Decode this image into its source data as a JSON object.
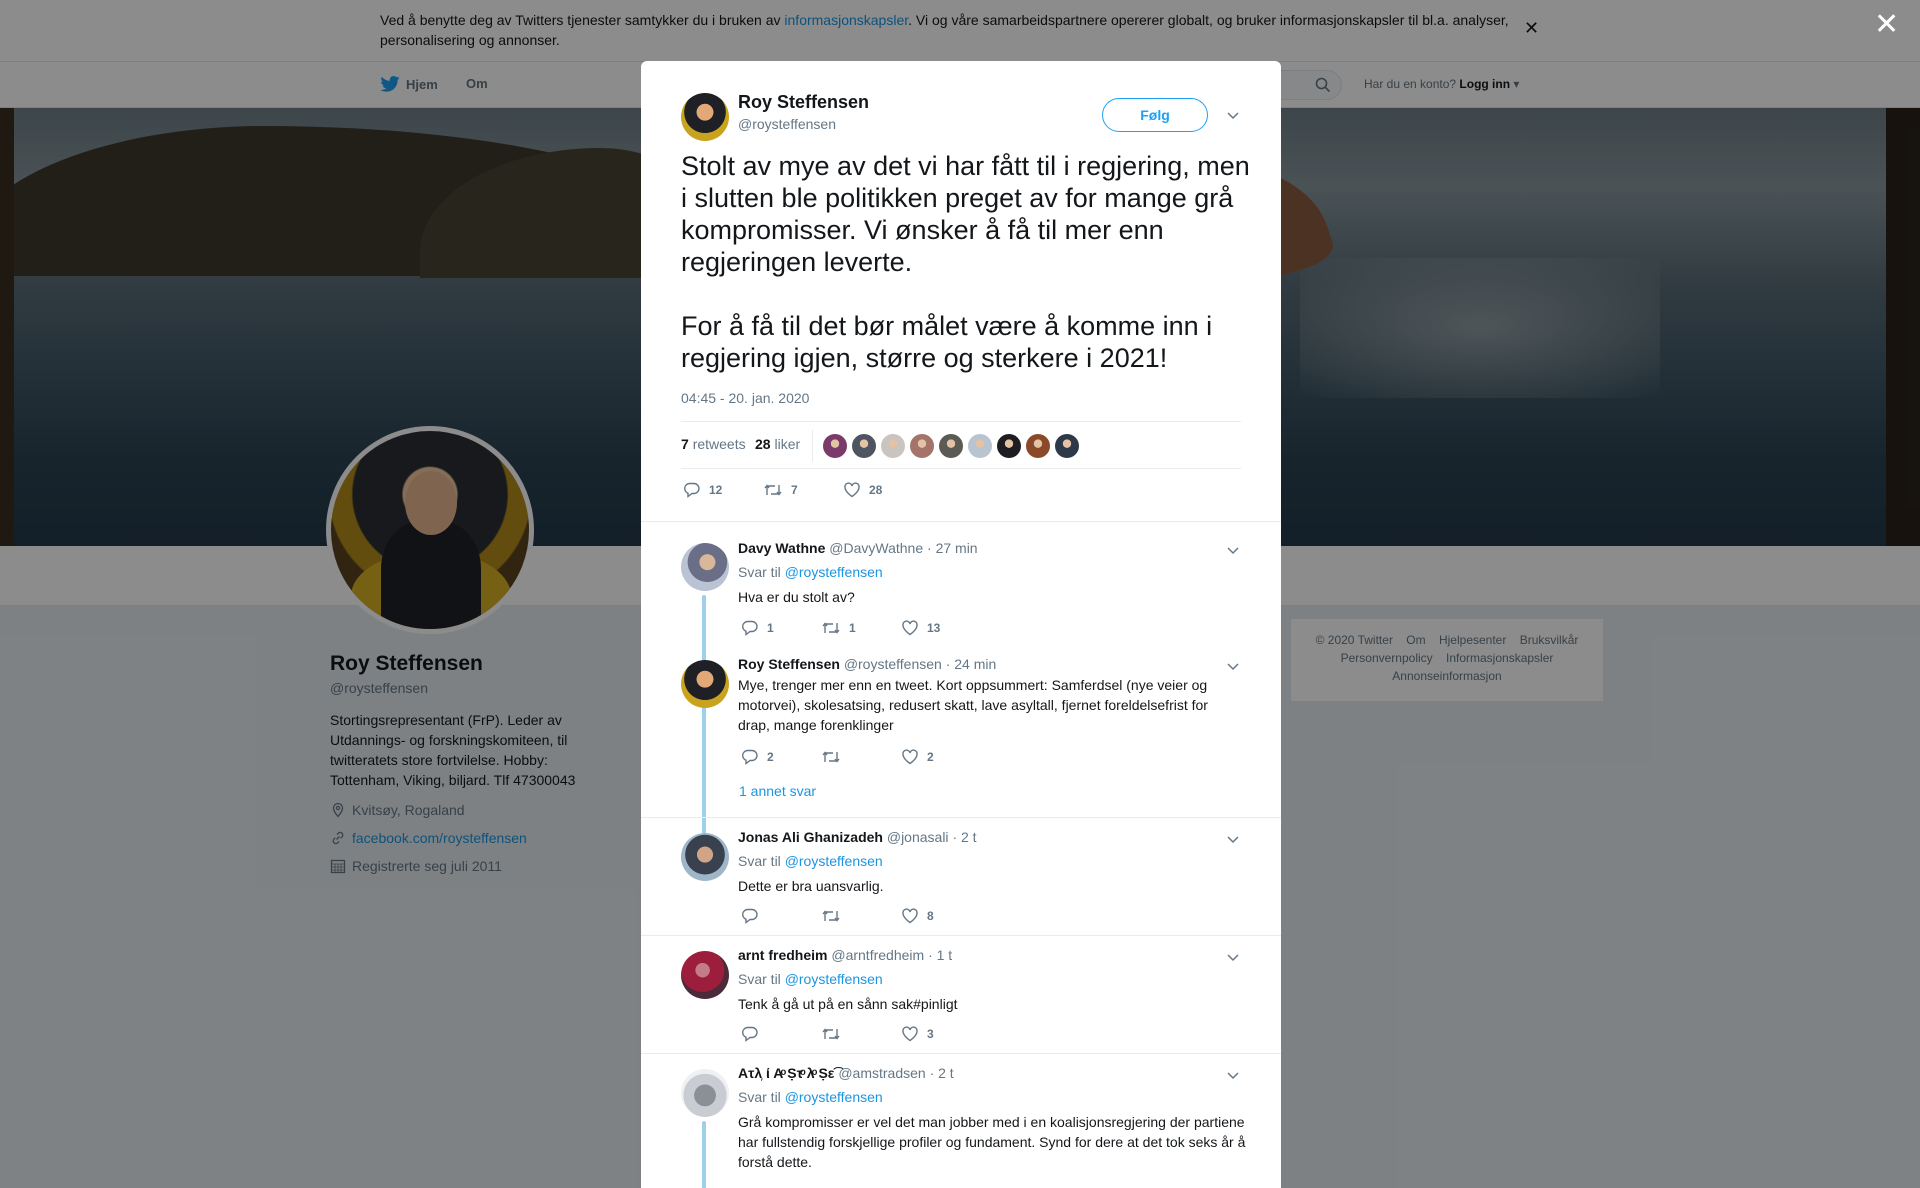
{
  "cookie_banner": {
    "text_before": "Ved å benytte deg av Twitters tjenester samtykker du i bruken av ",
    "link": "informasjonskapsler",
    "text_after": ". Vi og våre samarbeidspartnere opererer globalt, og bruker informasjonskapsler til bl.a. analyser, personalisering og annonser.",
    "close_icon": "close-icon"
  },
  "topnav": {
    "home": "Hjem",
    "about": "Om",
    "account_prompt": "Har du en konto?",
    "login": "Logg inn"
  },
  "profile": {
    "name": "Roy Steffensen",
    "handle": "@roysteffensen",
    "bio": "Stortingsrepresentant (FrP). Leder av Utdannings- og forskningskomiteen, til twitteratets store fortvilelse. Hobby: Tottenham, Viking, biljard. Tlf 47300043",
    "location": "Kvitsøy, Rogaland",
    "website": "facebook.com/roysteffensen",
    "joined": "Registrerte seg juli 2011"
  },
  "footer": {
    "items": [
      "© 2020 Twitter",
      "Om",
      "Hjelpesenter",
      "Bruksvilkår",
      "Personvernpolicy",
      "Informasjonskapsler",
      "Annonseinformasjon"
    ]
  },
  "tweet": {
    "author_name": "Roy Steffensen",
    "author_handle": "@roysteffensen",
    "follow_label": "Følg",
    "text": "Stolt av mye av det vi har fått til i regjering, men i slutten ble politikken preget av for mange grå kompromisser. Vi ønsker å få til mer enn regjeringen leverte.\n\nFor å få til det bør målet være å komme inn i regjering igjen, større og sterkere i 2021!",
    "timestamp": "04:45 - 20. jan. 2020",
    "retweets_count": "7",
    "retweets_label": "retweets",
    "likes_count": "28",
    "likes_label": "liker",
    "likers": [
      "#7a3a6a",
      "#4e5560",
      "#c9c4bf",
      "#a4746a",
      "#5b5a55",
      "#b8c4d0",
      "#1e1e22",
      "#8a4a2a",
      "#2d3848"
    ],
    "actions": {
      "replies": "12",
      "retweets": "7",
      "likes": "28"
    }
  },
  "replies": [
    {
      "name": "Davy Wathne",
      "handle": "@DavyWathne",
      "time": "· 27 min",
      "reply_to_label": "Svar til",
      "reply_to": "@roysteffensen",
      "text": "Hva er du stolt av?",
      "replies": "1",
      "retweets": "1",
      "likes": "13"
    },
    {
      "name": "Roy Steffensen",
      "handle": "@roysteffensen",
      "time": "· 24 min",
      "text": "Mye, trenger mer enn en tweet. Kort oppsummert: Samferdsel (nye veier og motorvei), skolesatsing, redusert skatt, lave asyltall, fjernet foreldelsefrist for drap, mange forenklinger",
      "replies": "2",
      "retweets": "",
      "likes": "2",
      "more": "1 annet svar"
    },
    {
      "name": "Jonas Ali Ghanizadeh",
      "handle": "@jonasali",
      "time": "· 2 t",
      "reply_to_label": "Svar til",
      "reply_to": "@roysteffensen",
      "text": "Dette er bra uansvarlig.",
      "replies": "",
      "retweets": "",
      "likes": "8"
    },
    {
      "name": "arnt fredheim",
      "handle": "@arntfredheim",
      "time": "· 1 t",
      "reply_to_label": "Svar til",
      "reply_to": "@roysteffensen",
      "text": "Tenk å gå ut på en sånn sak#pinligt",
      "replies": "",
      "retweets": "",
      "likes": "3"
    },
    {
      "name": "Ατλ᷊ ί Αͦ Ṣτͦ λͦ Ṣε͡",
      "handle": "@amstradsen",
      "time": "· 2 t",
      "reply_to_label": "Svar til",
      "reply_to": "@roysteffensen",
      "text": "Grå kompromisser er vel det man jobber med i en koalisjonsregjering der partiene har fullstendig forskjellige profiler og fundament. Synd for dere at det tok seks år å forstå dette."
    }
  ]
}
